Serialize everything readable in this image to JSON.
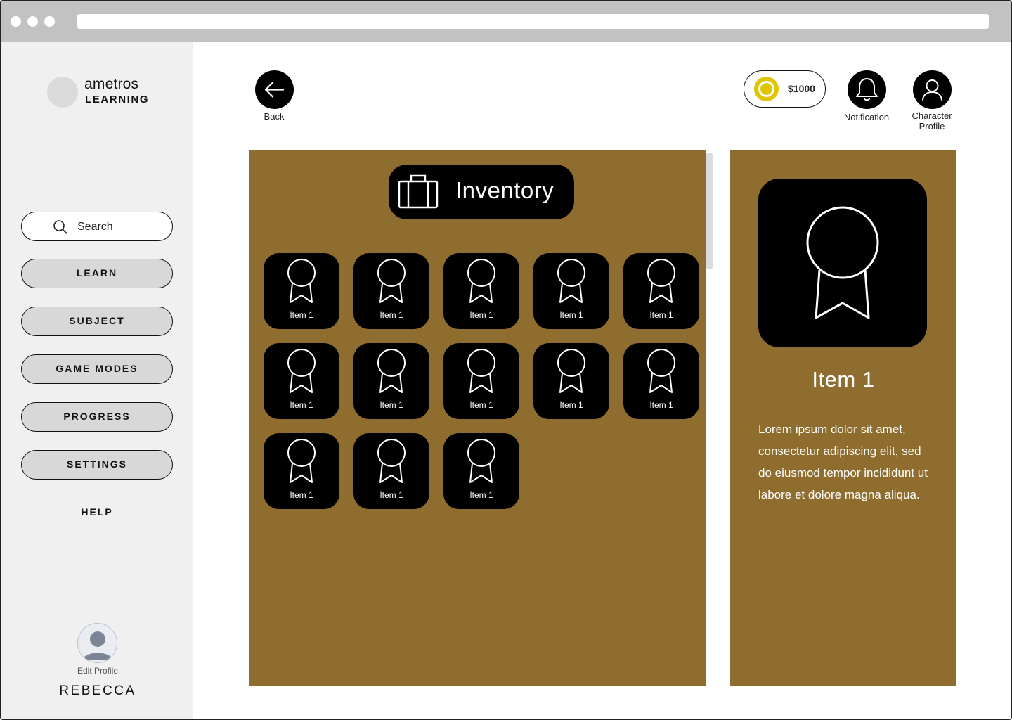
{
  "brand": {
    "name": "ametros",
    "sub": "LEARNING"
  },
  "search": {
    "placeholder": "Search"
  },
  "nav": {
    "items": [
      {
        "label": "LEARN"
      },
      {
        "label": "SUBJECT"
      },
      {
        "label": "GAME MODES"
      },
      {
        "label": "PROGRESS"
      },
      {
        "label": "SETTINGS"
      }
    ],
    "help": "HELP"
  },
  "profile": {
    "edit_label": "Edit Profile",
    "username": "REBECCA"
  },
  "topbar": {
    "back_label": "Back",
    "coins": "$1000",
    "notification_label": "Notification",
    "character_profile_label_line1": "Character",
    "character_profile_label_line2": "Profile"
  },
  "inventory": {
    "title": "Inventory",
    "items": [
      {
        "label": "Item 1"
      },
      {
        "label": "Item 1"
      },
      {
        "label": "Item 1"
      },
      {
        "label": "Item 1"
      },
      {
        "label": "Item 1"
      },
      {
        "label": "Item 1"
      },
      {
        "label": "Item 1"
      },
      {
        "label": "Item 1"
      },
      {
        "label": "Item 1"
      },
      {
        "label": "Item 1"
      },
      {
        "label": "Item 1"
      },
      {
        "label": "Item 1"
      },
      {
        "label": "Item 1"
      }
    ]
  },
  "detail": {
    "name": "Item 1",
    "description": "Lorem ipsum dolor sit amet, consectetur adipiscing elit, sed do eiusmod tempor incididunt ut labore et dolore magna aliqua."
  },
  "colors": {
    "panel_brown": "#8e6d2f",
    "sidebar_bg": "#f0f0f0",
    "nav_button_bg": "#d8d8d8",
    "coin_yellow": "#e1c400",
    "chrome_gray": "#c2c2c2"
  },
  "icons": {
    "back": "arrow-left-icon",
    "coin": "coin-icon",
    "notification": "bell-icon",
    "character": "user-icon",
    "inventory": "briefcase-icon",
    "item": "award-ribbon-icon",
    "search": "search-icon"
  }
}
